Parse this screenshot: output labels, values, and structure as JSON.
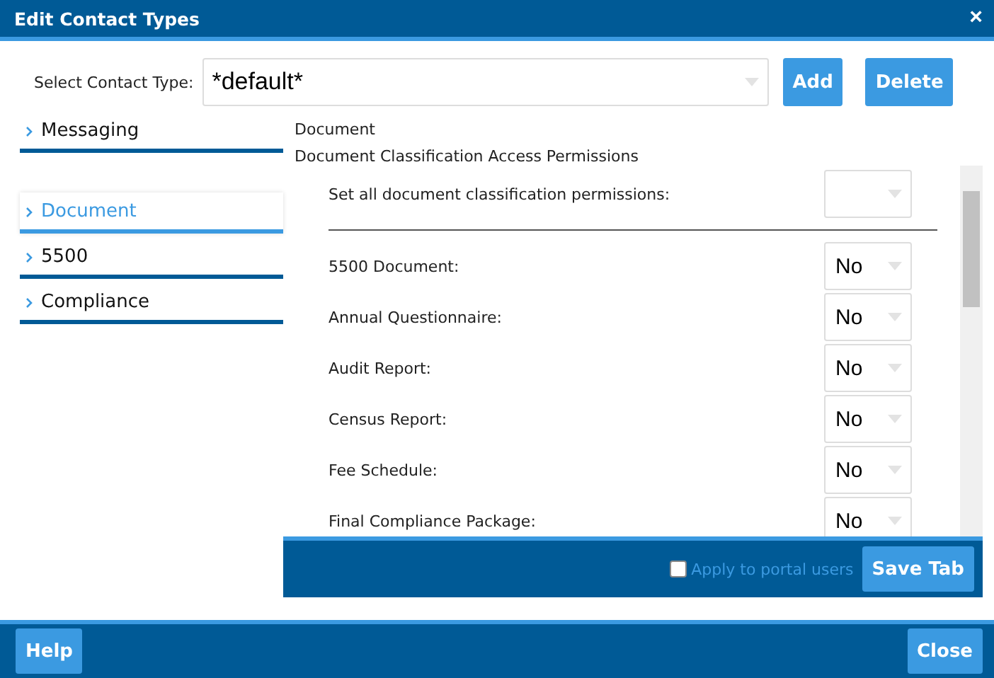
{
  "window": {
    "title": "Edit Contact Types",
    "close": "×"
  },
  "contact_type": {
    "label": "Select Contact Type:",
    "value": "*default*"
  },
  "top_buttons": [
    "Add",
    "Delete"
  ],
  "sidebar": {
    "items": [
      {
        "label": "Messaging",
        "selected": false,
        "kind": "group"
      },
      {
        "label": "Document",
        "selected": true,
        "kind": "tab"
      },
      {
        "label": "5500",
        "selected": false,
        "kind": "tab"
      },
      {
        "label": "Compliance",
        "selected": false,
        "kind": "tab"
      }
    ]
  },
  "panel": {
    "heading": "Document",
    "subheading": "Document Classification Access Permissions",
    "set_all": {
      "label": "Set all document classification permissions:"
    },
    "permissions": [
      {
        "label": "5500 Document:",
        "value": "No"
      },
      {
        "label": "Annual Questionnaire:",
        "value": "No"
      },
      {
        "label": "Audit Report:",
        "value": "No"
      },
      {
        "label": "Census Report:",
        "value": "No"
      },
      {
        "label": "Fee Schedule:",
        "value": "No"
      },
      {
        "label": "Final Compliance Package:",
        "value": "No"
      }
    ],
    "apply_portal": {
      "label": "Apply to portal users",
      "checked": false
    },
    "save": "Save Tab"
  },
  "footer": {
    "buttons": [
      "Help",
      "Close"
    ]
  }
}
